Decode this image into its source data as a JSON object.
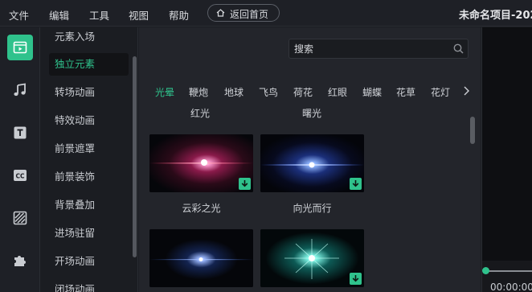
{
  "menubar": {
    "items": [
      "文件",
      "编辑",
      "工具",
      "视图",
      "帮助"
    ],
    "home_button": "返回首页",
    "project_title": "未命名项目-202"
  },
  "rail": {
    "items": [
      {
        "name": "media-icon",
        "active": true
      },
      {
        "name": "music-icon",
        "active": false
      },
      {
        "name": "text-icon",
        "active": false
      },
      {
        "name": "caption-icon",
        "active": false
      },
      {
        "name": "filter-icon",
        "active": false
      },
      {
        "name": "plugin-icon",
        "active": false
      }
    ]
  },
  "categories": {
    "items": [
      "元素入场",
      "独立元素",
      "转场动画",
      "特效动画",
      "前景遮罩",
      "前景装饰",
      "背景叠加",
      "进场驻留",
      "开场动画",
      "闭场动画"
    ],
    "active_index": 1
  },
  "search": {
    "placeholder": "搜索"
  },
  "tabs": {
    "items": [
      "光晕",
      "鞭炮",
      "地球",
      "飞鸟",
      "荷花",
      "红眼",
      "蝴蝶",
      "花草",
      "花灯"
    ],
    "active_index": 0
  },
  "cut_labels": [
    "红光",
    "曙光"
  ],
  "thumbnails": [
    {
      "label": "云彩之光",
      "style": "red-flare"
    },
    {
      "label": "向光而行",
      "style": "blue-flare"
    },
    {
      "label": "",
      "style": "blue-point"
    },
    {
      "label": "",
      "style": "cyan-star"
    }
  ],
  "preview": {
    "timecode": "00:00:00"
  },
  "colors": {
    "accent": "#2fc28c",
    "background": "#1b1d22",
    "panel": "#23252b"
  }
}
